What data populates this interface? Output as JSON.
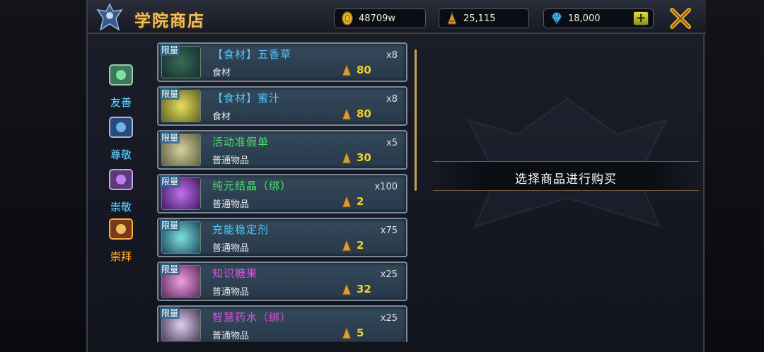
{
  "header": {
    "title": "学院商店",
    "currency_gold": "48709w",
    "currency_badge": "25,115",
    "currency_gem": "18,000",
    "plus_label": "+"
  },
  "side_tabs": [
    {
      "label": "友善",
      "icon": "green-crest-icon",
      "active": false
    },
    {
      "label": "尊敬",
      "icon": "blue-crest-icon",
      "active": false
    },
    {
      "label": "崇敬",
      "icon": "purple-crest-icon",
      "active": false
    },
    {
      "label": "崇拜",
      "icon": "gold-crest-icon",
      "active": true
    }
  ],
  "items": [
    {
      "limit": "限量",
      "name": "【食材】五香草",
      "name_color": "#4ec8ff",
      "category": "食材",
      "qty": "x8",
      "price": "80"
    },
    {
      "limit": "限量",
      "name": "【食材】蜜汁",
      "name_color": "#4ec8ff",
      "category": "食材",
      "qty": "x8",
      "price": "80"
    },
    {
      "limit": "限量",
      "name": "活动准假单",
      "name_color": "#4ee070",
      "category": "普通物品",
      "qty": "x5",
      "price": "30"
    },
    {
      "limit": "限量",
      "name": "纯元结晶（绑）",
      "name_color": "#4ee070",
      "category": "普通物品",
      "qty": "x100",
      "price": "2"
    },
    {
      "limit": "限量",
      "name": "充能稳定剂",
      "name_color": "#4ec8ff",
      "category": "普通物品",
      "qty": "x75",
      "price": "2"
    },
    {
      "limit": "限量",
      "name": "知识糖果",
      "name_color": "#e050e0",
      "category": "普通物品",
      "qty": "x25",
      "price": "32"
    },
    {
      "limit": "限量",
      "name": "智慧药水（绑）",
      "name_color": "#e050e0",
      "category": "普通物品",
      "qty": "x25",
      "price": "5"
    }
  ],
  "detail": {
    "prompt": "选择商品进行购买"
  },
  "colors": {
    "title": "#f0c060",
    "price": "#f0d030",
    "tab_active": "#ffb030",
    "tab_inactive": "#6fd4ff"
  }
}
